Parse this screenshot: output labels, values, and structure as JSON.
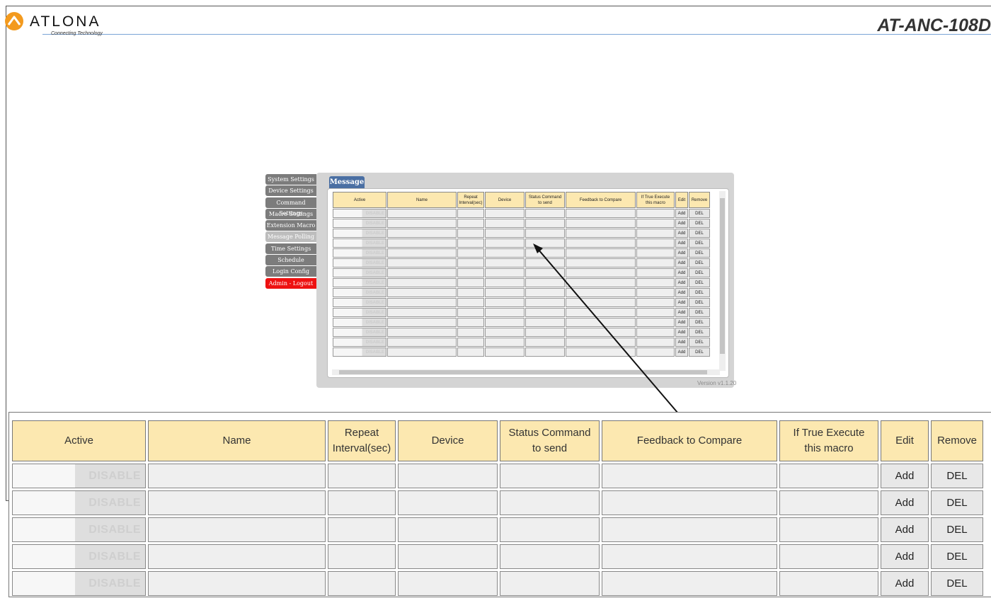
{
  "brand": {
    "name": "ATLONA",
    "tagline": "Connecting Technology",
    "model": "AT-ANC-108D"
  },
  "sidebar": {
    "items": [
      {
        "label": "System Settings"
      },
      {
        "label": "Device Settings"
      },
      {
        "label": "Command Settings"
      },
      {
        "label": "Macro Settings"
      },
      {
        "label": "Extension Macro"
      },
      {
        "label": "Message Polling"
      },
      {
        "label": "Time Settings"
      },
      {
        "label": "Schedule"
      },
      {
        "label": "Login Config"
      },
      {
        "label": "Admin - Logout"
      }
    ],
    "active_index": 5
  },
  "tab": {
    "label": "Message"
  },
  "table": {
    "headers": {
      "active": "Active",
      "name": "Name",
      "repeat_line1": "Repeat",
      "repeat_line2": "Interval(sec)",
      "device": "Device",
      "status_line1": "Status Command",
      "status_line2": "to send",
      "feedback": "Feedback to Compare",
      "macro_line1": "If True Execute",
      "macro_line2": "this macro",
      "edit": "Edit",
      "remove": "Remove"
    },
    "toggle_label": "DISABLE",
    "add_label": "Add",
    "del_label": "DEL",
    "mini_row_count": 15,
    "zoom_row_count": 5
  },
  "version": "Version v1.1.20",
  "colors": {
    "header_fill": "#fce8b0",
    "tab": "#4a6fa3",
    "logout": "#ee1111",
    "nav": "#7c7c7c",
    "logo_orange": "#f39a1e"
  }
}
